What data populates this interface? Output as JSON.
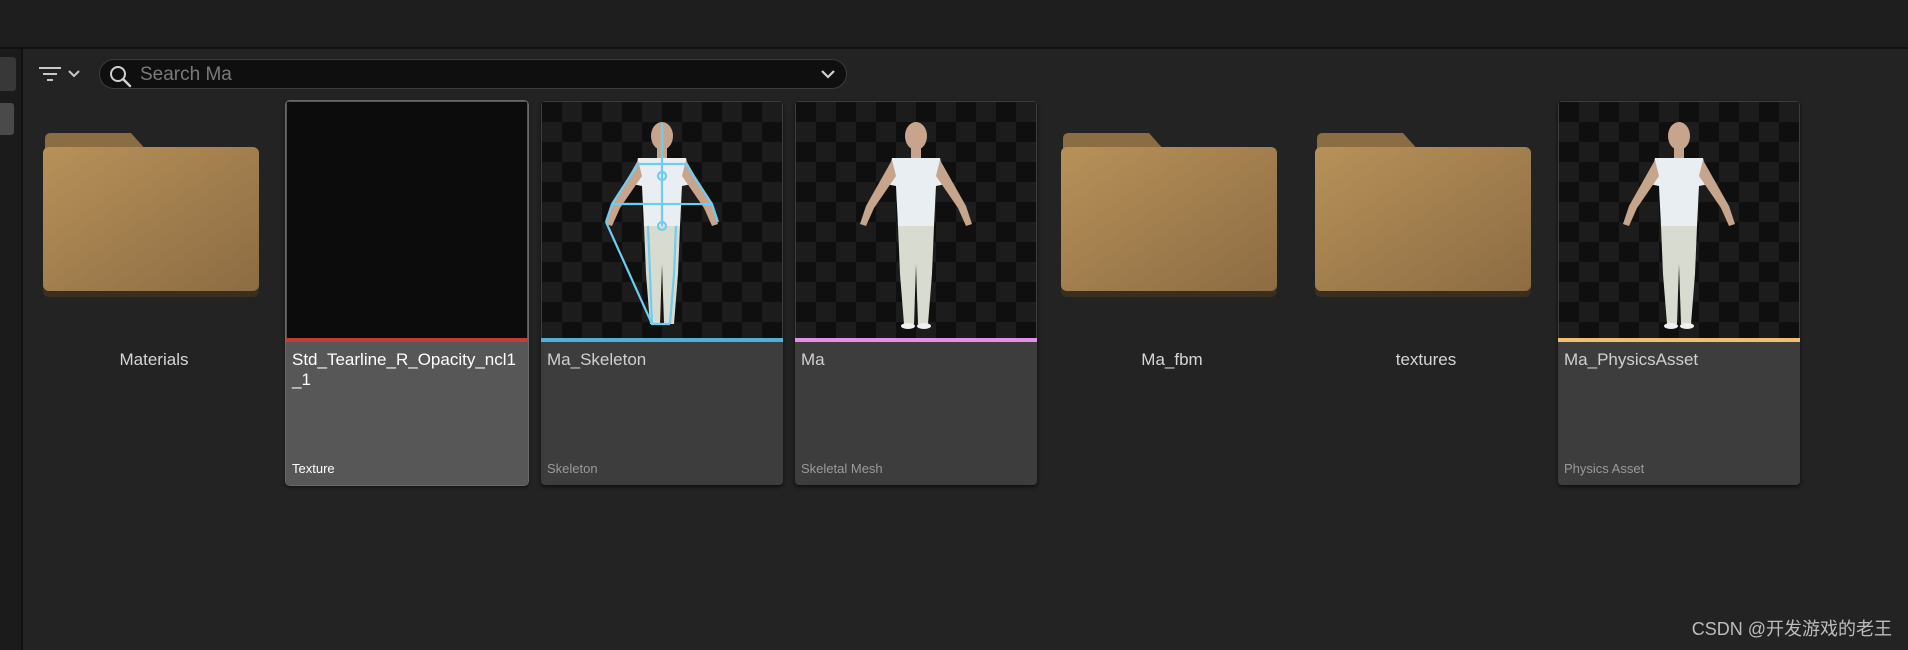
{
  "search": {
    "placeholder": "Search Ma",
    "value": ""
  },
  "toolbar": {
    "filter_icon": "filter-icon",
    "chevron_icon": "chevron-down-icon"
  },
  "items": [
    {
      "kind": "folder",
      "name": "Materials"
    },
    {
      "kind": "asset",
      "name": "Std_Tearline_R_Opacity_ncl1_1",
      "type": "Texture",
      "color": "#c23b3b",
      "selected": true
    },
    {
      "kind": "asset",
      "name": "Ma_Skeleton",
      "type": "Skeleton",
      "color": "#52b0d6"
    },
    {
      "kind": "asset",
      "name": "Ma",
      "type": "Skeletal Mesh",
      "color": "#e58fe8"
    },
    {
      "kind": "folder",
      "name": "Ma_fbm"
    },
    {
      "kind": "folder",
      "name": "textures"
    },
    {
      "kind": "asset",
      "name": "Ma_PhysicsAsset",
      "type": "Physics Asset",
      "color": "#f0c070"
    }
  ],
  "watermark": "CSDN @开发游戏的老王"
}
